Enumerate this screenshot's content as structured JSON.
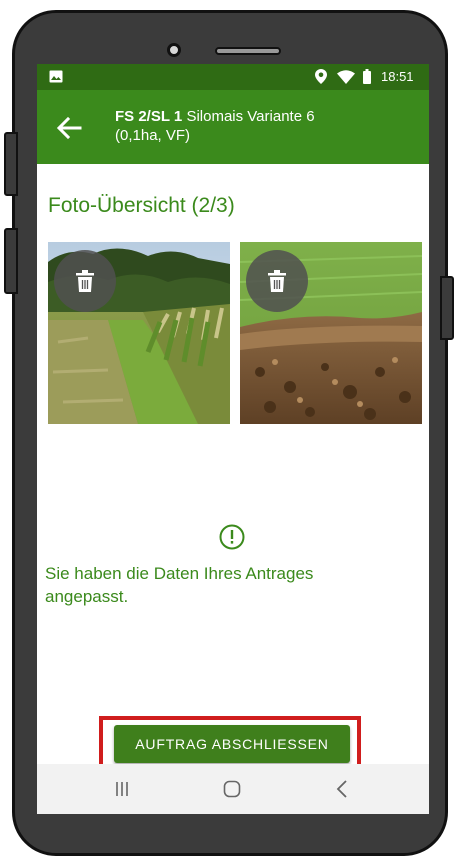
{
  "status_bar": {
    "time": "18:51"
  },
  "app_bar": {
    "title_bold": "FS 2/SL 1",
    "title_rest": "Silomais Variante 6",
    "subtitle": "(0,1ha, VF)"
  },
  "content": {
    "heading": "Foto-Übersicht (2/3)",
    "notice": "Sie haben die Daten Ihres Antrages angepasst.",
    "primary_button": "AUFTRAG ABSCHLIESSEN"
  },
  "colors": {
    "accent": "#3f7f1c",
    "appbar": "#3b8a1c",
    "statusbar": "#2f6b14",
    "highlight": "#d01d1d"
  }
}
